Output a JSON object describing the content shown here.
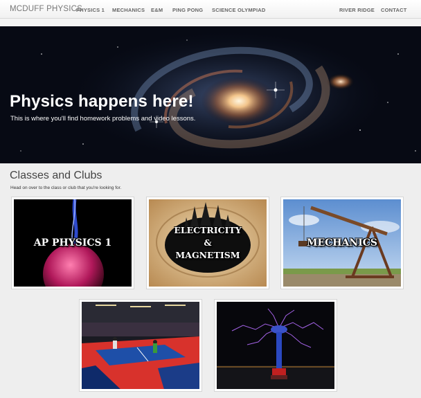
{
  "navbar": {
    "brand": "MCDUFF PHYSICS",
    "links": [
      "PHYSICS 1",
      "MECHANICS",
      "E&M",
      "PING PONG",
      "SCIENCE OLYMPIAD"
    ],
    "right_links": [
      "RIVER RIDGE",
      "CONTACT"
    ]
  },
  "hero": {
    "title": "Physics happens here!",
    "subtitle": "This is where you'll find homework problems and video lessons."
  },
  "classes": {
    "title": "Classes and Clubs",
    "subtitle": "Head on over to the class or club that you're looking for.",
    "cards": [
      {
        "label": "AP PHYSICS 1"
      },
      {
        "label_line1": "ELECTRICITY",
        "label_line2": "&",
        "label_line3": "MAGNETISM"
      },
      {
        "label": "MECHANICS"
      },
      {
        "label": ""
      },
      {
        "label": ""
      }
    ]
  },
  "colors": {
    "page_background": "#eeeeee",
    "nav_text": "#666666",
    "hero_text": "#ffffff"
  }
}
